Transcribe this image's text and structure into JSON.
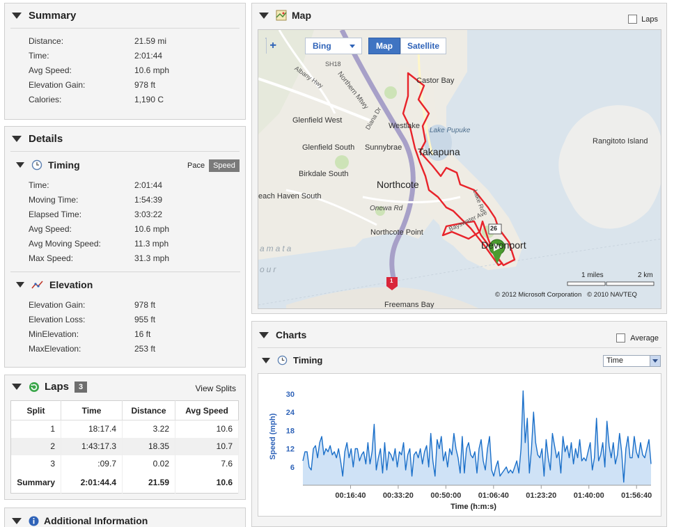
{
  "summary": {
    "title": "Summary",
    "rows": [
      {
        "label": "Distance:",
        "value": "21.59 mi"
      },
      {
        "label": "Time:",
        "value": "2:01:44"
      },
      {
        "label": "Avg Speed:",
        "value": "10.6 mph"
      },
      {
        "label": "Elevation Gain:",
        "value": "978 ft"
      },
      {
        "label": "Calories:",
        "value": "1,190 C"
      }
    ]
  },
  "details": {
    "title": "Details",
    "timing": {
      "title": "Timing",
      "toggle": [
        "Pace",
        "Speed"
      ],
      "active_toggle": "Speed",
      "rows": [
        {
          "label": "Time:",
          "value": "2:01:44"
        },
        {
          "label": "Moving Time:",
          "value": "1:54:39"
        },
        {
          "label": "Elapsed Time:",
          "value": "3:03:22"
        },
        {
          "label": "Avg Speed:",
          "value": "10.6 mph"
        },
        {
          "label": "Avg Moving Speed:",
          "value": "11.3 mph"
        },
        {
          "label": "Max Speed:",
          "value": "31.3 mph"
        }
      ]
    },
    "elevation": {
      "title": "Elevation",
      "rows": [
        {
          "label": "Elevation Gain:",
          "value": "978 ft"
        },
        {
          "label": "Elevation Loss:",
          "value": "955 ft"
        },
        {
          "label": "MinElevation:",
          "value": "16 ft"
        },
        {
          "label": "MaxElevation:",
          "value": "253 ft"
        }
      ]
    }
  },
  "laps": {
    "title": "Laps",
    "count": "3",
    "view_splits": "View Splits",
    "columns": [
      "Split",
      "Time",
      "Distance",
      "Avg Speed"
    ],
    "rows": [
      [
        "1",
        "18:17.4",
        "3.22",
        "10.6"
      ],
      [
        "2",
        "1:43:17.3",
        "18.35",
        "10.7"
      ],
      [
        "3",
        ":09.7",
        "0.02",
        "7.6"
      ]
    ],
    "summary": [
      "Summary",
      "2:01:44.4",
      "21.59",
      "10.6"
    ]
  },
  "additional": {
    "title": "Additional Information"
  },
  "map": {
    "title": "Map",
    "laps_label": "Laps",
    "provider": "Bing",
    "modes": [
      "Map",
      "Satellite"
    ],
    "active_mode": "Map",
    "places": [
      "Castor Bay",
      "Glenfield West",
      "Westlake",
      "Lake Pupuke",
      "Takapuna",
      "Glenfield South",
      "Sunnybrae",
      "Rangitoto Island",
      "Birkdale South",
      "Northcote",
      "each Haven South",
      "Onewa Rd",
      "Northcote Point",
      "Devonport",
      "Freemans Bay",
      "Northern Mtwy",
      "Albany Hwy",
      "Diana Dr",
      "SH18",
      "Bayswater Ave",
      "Lake Rd",
      "amata",
      "our"
    ],
    "scale_miles": "1 miles",
    "scale_km": "2 km",
    "copyright": "© 2012 Microsoft Corporation   © 2010 NAVTEQ",
    "shields": [
      "26",
      "1"
    ]
  },
  "charts": {
    "title": "Charts",
    "average_label": "Average",
    "sub_title": "Timing",
    "select_value": "Time"
  },
  "chart_data": {
    "type": "area",
    "ylabel": "Speed (mph)",
    "xlabel": "Time (h:m:s)",
    "yticks": [
      "6",
      "12",
      "18",
      "24",
      "30"
    ],
    "xticks": [
      "00:16:40",
      "00:33:20",
      "00:50:00",
      "01:06:40",
      "01:23:20",
      "01:40:00",
      "01:56:40"
    ],
    "ylim": [
      0,
      32
    ],
    "xlim_seconds": [
      0,
      7304
    ],
    "series": [
      {
        "values": [
          8,
          11,
          11,
          6,
          5,
          12,
          13,
          9,
          14,
          16,
          10,
          12,
          11,
          13,
          10,
          11,
          9,
          12,
          8,
          3,
          11,
          14,
          9,
          12,
          6,
          12,
          12,
          8,
          10,
          11,
          7,
          14,
          7,
          11,
          20,
          5,
          9,
          12,
          4,
          14,
          5,
          11,
          10,
          8,
          12,
          6,
          11,
          10,
          14,
          5,
          10,
          12,
          3,
          10,
          11,
          9,
          12,
          7,
          11,
          13,
          6,
          17,
          8,
          3,
          15,
          12,
          16,
          8,
          11,
          6,
          12,
          10,
          17,
          12,
          9,
          4,
          16,
          4,
          12,
          14,
          10,
          9,
          11,
          4,
          12,
          15,
          8,
          5,
          12,
          16,
          5,
          3,
          6,
          8,
          3,
          4,
          5,
          6,
          4,
          5,
          4,
          6,
          8,
          4,
          12,
          31,
          14,
          22,
          4,
          12,
          24,
          14,
          10,
          9,
          12,
          3,
          15,
          9,
          5,
          17,
          13,
          9,
          11,
          4,
          16,
          11,
          13,
          9,
          14,
          7,
          12,
          9,
          15,
          8,
          9,
          8,
          11,
          14,
          5,
          9,
          22,
          8,
          10,
          14,
          6,
          21,
          13,
          9,
          14,
          7,
          10,
          17,
          11,
          1,
          12,
          16,
          9,
          9,
          16,
          11,
          9,
          14,
          10,
          9,
          12,
          15,
          7
        ]
      }
    ]
  }
}
